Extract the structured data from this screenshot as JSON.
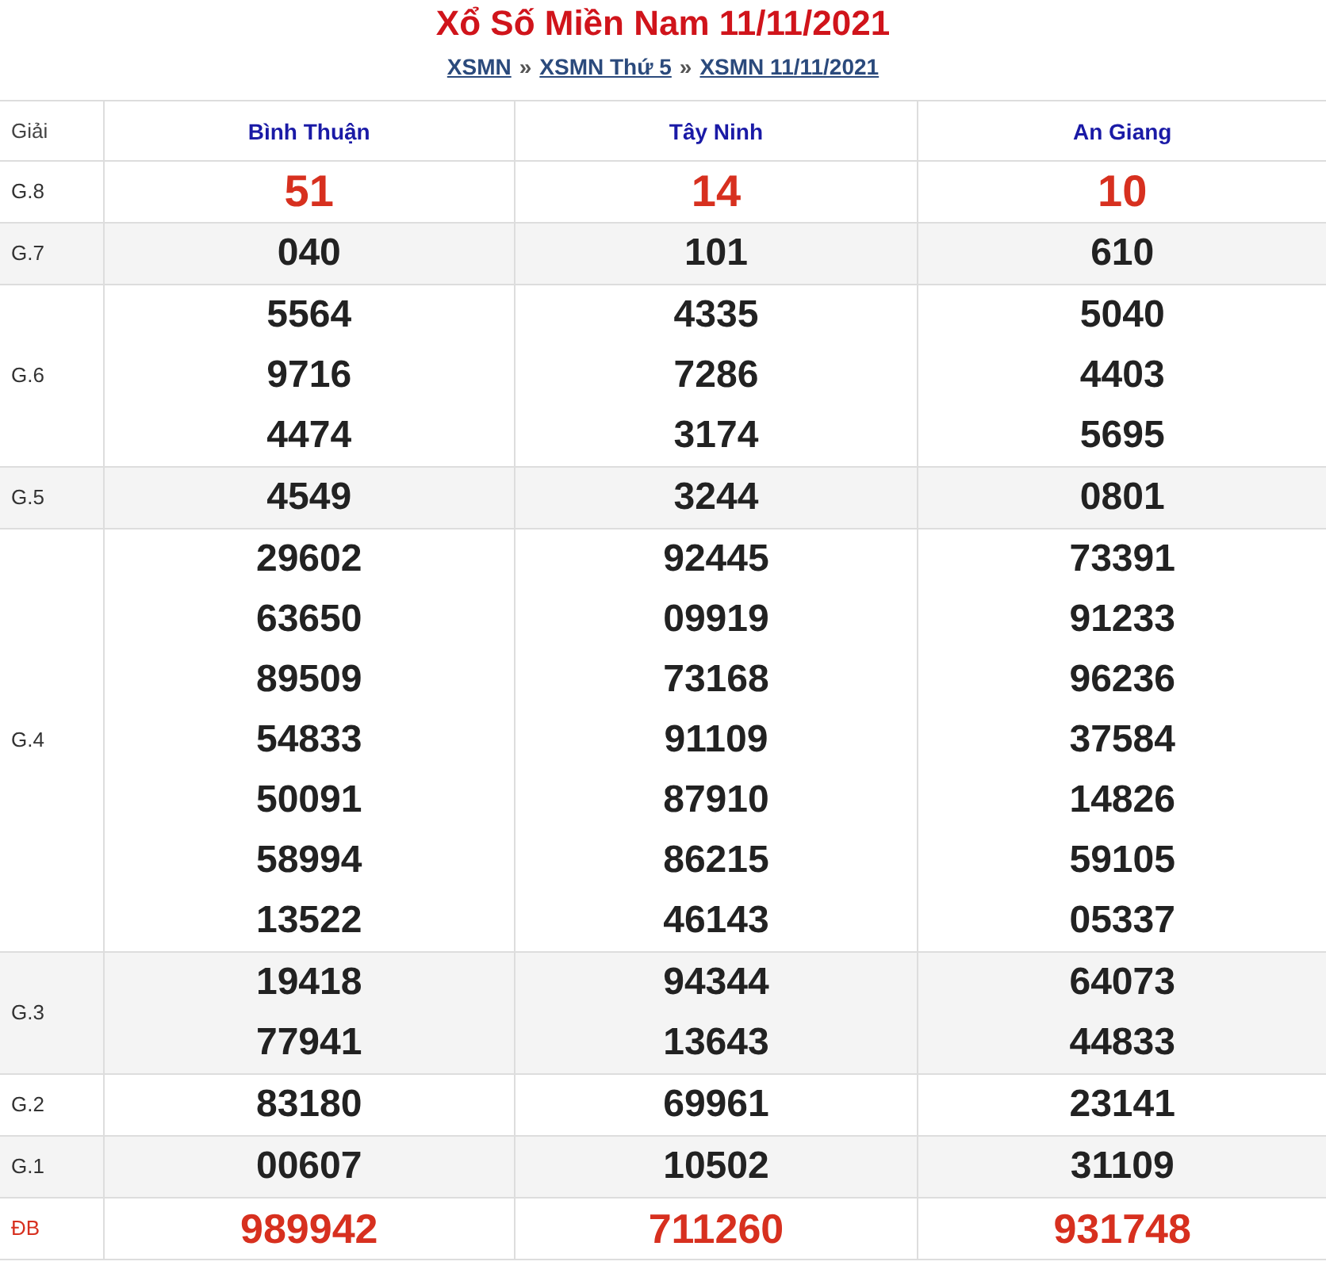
{
  "title": "Xổ Số Miền Nam 11/11/2021",
  "breadcrumb": [
    {
      "kind": "link",
      "label": "XSMN"
    },
    {
      "kind": "separator",
      "label": "»"
    },
    {
      "kind": "link",
      "label": "XSMN Thứ 5"
    },
    {
      "kind": "separator",
      "label": "»"
    },
    {
      "kind": "link",
      "label": "XSMN 11/11/2021"
    }
  ],
  "table": {
    "columns": [
      "Giải",
      "Bình Thuận",
      "Tây Ninh",
      "An Giang"
    ],
    "rows": [
      {
        "label": "G.8",
        "kind": "highlight",
        "values": [
          [
            "51"
          ],
          [
            "14"
          ],
          [
            "10"
          ]
        ]
      },
      {
        "label": "G.7",
        "kind": "normal",
        "values": [
          [
            "040"
          ],
          [
            "101"
          ],
          [
            "610"
          ]
        ]
      },
      {
        "label": "G.6",
        "kind": "normal",
        "values": [
          [
            "5564",
            "9716",
            "4474"
          ],
          [
            "4335",
            "7286",
            "3174"
          ],
          [
            "5040",
            "4403",
            "5695"
          ]
        ]
      },
      {
        "label": "G.5",
        "kind": "normal",
        "values": [
          [
            "4549"
          ],
          [
            "3244"
          ],
          [
            "0801"
          ]
        ]
      },
      {
        "label": "G.4",
        "kind": "normal",
        "values": [
          [
            "29602",
            "63650",
            "89509",
            "54833",
            "50091",
            "58994",
            "13522"
          ],
          [
            "92445",
            "09919",
            "73168",
            "91109",
            "87910",
            "86215",
            "46143"
          ],
          [
            "73391",
            "91233",
            "96236",
            "37584",
            "14826",
            "59105",
            "05337"
          ]
        ]
      },
      {
        "label": "G.3",
        "kind": "normal",
        "values": [
          [
            "19418",
            "77941"
          ],
          [
            "94344",
            "13643"
          ],
          [
            "64073",
            "44833"
          ]
        ]
      },
      {
        "label": "G.2",
        "kind": "normal",
        "values": [
          [
            "83180"
          ],
          [
            "69961"
          ],
          [
            "23141"
          ]
        ]
      },
      {
        "label": "G.1",
        "kind": "normal",
        "values": [
          [
            "00607"
          ],
          [
            "10502"
          ],
          [
            "31109"
          ]
        ]
      },
      {
        "label": "ĐB",
        "kind": "jackpot",
        "values": [
          [
            "989942"
          ],
          [
            "711260"
          ],
          [
            "931748"
          ]
        ]
      }
    ]
  }
}
